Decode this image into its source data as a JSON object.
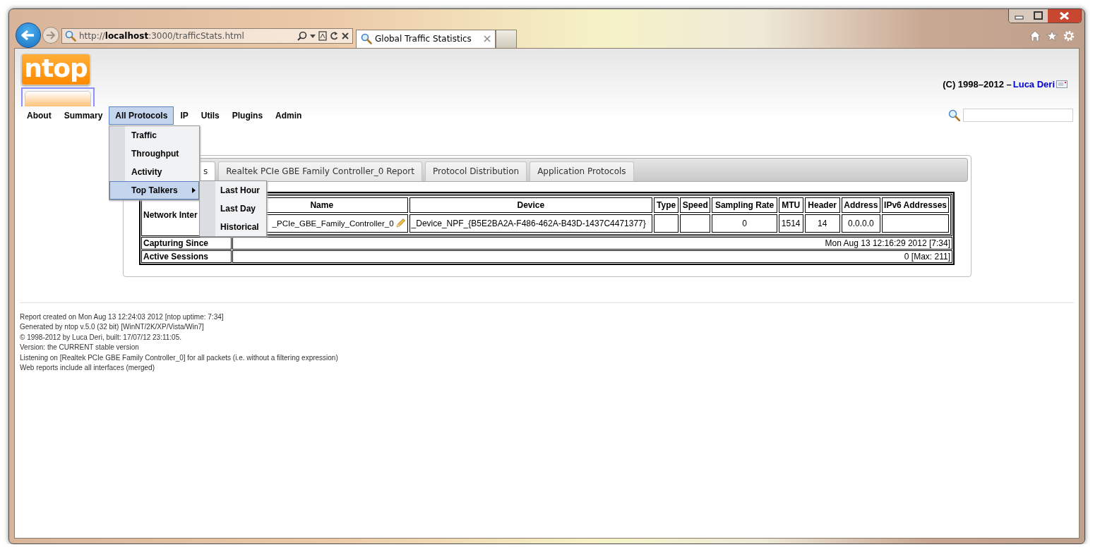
{
  "browser": {
    "address": "http://**localhost**:3000/trafficStats.html",
    "tabs": [
      {
        "label": "Global Traffic Statistics",
        "selected": true
      }
    ]
  },
  "header": {
    "logo": "ntop",
    "copyright": "(C) 1998–2012 – ",
    "author_link": "Luca Deri"
  },
  "nav": [
    {
      "label": "About",
      "selected": false
    },
    {
      "label": "Summary",
      "selected": false
    },
    {
      "label": "All Protocols",
      "selected": true
    },
    {
      "label": "IP",
      "selected": false
    },
    {
      "label": "Utils",
      "selected": false
    },
    {
      "label": "Plugins",
      "selected": false
    },
    {
      "label": "Admin",
      "selected": false
    }
  ],
  "menu": {
    "items": [
      {
        "label": "Traffic",
        "selected": false,
        "has_submenu": false
      },
      {
        "label": "Throughput",
        "selected": false,
        "has_submenu": false
      },
      {
        "label": "Activity",
        "selected": false,
        "has_submenu": false
      },
      {
        "label": "Top Talkers",
        "selected": true,
        "has_submenu": true
      }
    ],
    "submenu": [
      "Last Hour",
      "Last Day",
      "Historical"
    ]
  },
  "panel": {
    "tabs": [
      {
        "label": "s",
        "selected": true
      },
      {
        "label": "Realtek PCIe GBE Family Controller_0 Report",
        "selected": false
      },
      {
        "label": "Protocol Distribution",
        "selected": false
      },
      {
        "label": "Application Protocols",
        "selected": false
      }
    ],
    "interface": {
      "row_label": "Network Inter",
      "columns": [
        {
          "header": "Name",
          "value": "_PCIe_GBE_Family_Controller_0"
        },
        {
          "header": "Device",
          "value": "_Device_NPF_{B5E2BA2A-F486-462A-B43D-1437C4471377}"
        },
        {
          "header": "Type"
        },
        {
          "header": "Speed"
        },
        {
          "header": "Sampling Rate",
          "value": "0"
        },
        {
          "header": "MTU",
          "value": "1514"
        },
        {
          "header": "Header",
          "value": "14"
        },
        {
          "header": "Address",
          "value": "0.0.0.0"
        },
        {
          "header": "IPv6 Addresses"
        }
      ]
    },
    "rows": [
      {
        "label": "Capturing Since",
        "value": "Mon Aug 13 12:16:29 2012 [7:34]"
      },
      {
        "label": "Active Sessions",
        "value": "0 [Max: 211]"
      }
    ]
  },
  "footer": [
    "Report created on Mon Aug 13 12:24:03 2012 [ntop uptime: 7:34]",
    "Generated by ntop v.5.0 (32 bit) [WinNT/2K/XP/Vista/Win7]",
    "© 1998-2012 by Luca Deri, built: 17/07/12 23:11:05.",
    "Version: the CURRENT stable version",
    "Listening on [Realtek PCIe GBE Family Controller_0] for all packets (i.e. without a filtering expression)",
    "Web reports include all interfaces (merged)"
  ]
}
